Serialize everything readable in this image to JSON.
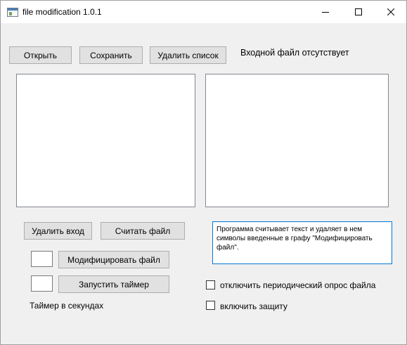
{
  "window": {
    "title": "file modification 1.0.1",
    "controls": {
      "minimize_icon": "minimize-icon",
      "maximize_icon": "maximize-icon",
      "close_icon": "close-icon"
    }
  },
  "toolbar": {
    "open_label": "Открыть",
    "save_label": "Сохранить",
    "clear_list_label": "Удалить список",
    "status_text": "Входной файл отсутствует"
  },
  "left_panel": {
    "delete_input_label": "Удалить вход",
    "read_file_label": "Считать файл",
    "modify_value": "",
    "modify_label": "Модифицировать файл",
    "timer_value": "",
    "start_timer_label": "Запустить таймер",
    "timer_caption": "Таймер в секундах"
  },
  "right_panel": {
    "info_text": "Программа считывает текст и удаляет в нем символы введенные в графу \"Модифицировать файл\".",
    "disable_polling_label": "отключить периодический опрос файла",
    "disable_polling_checked": false,
    "enable_protection_label": "включить защиту",
    "enable_protection_checked": false
  }
}
